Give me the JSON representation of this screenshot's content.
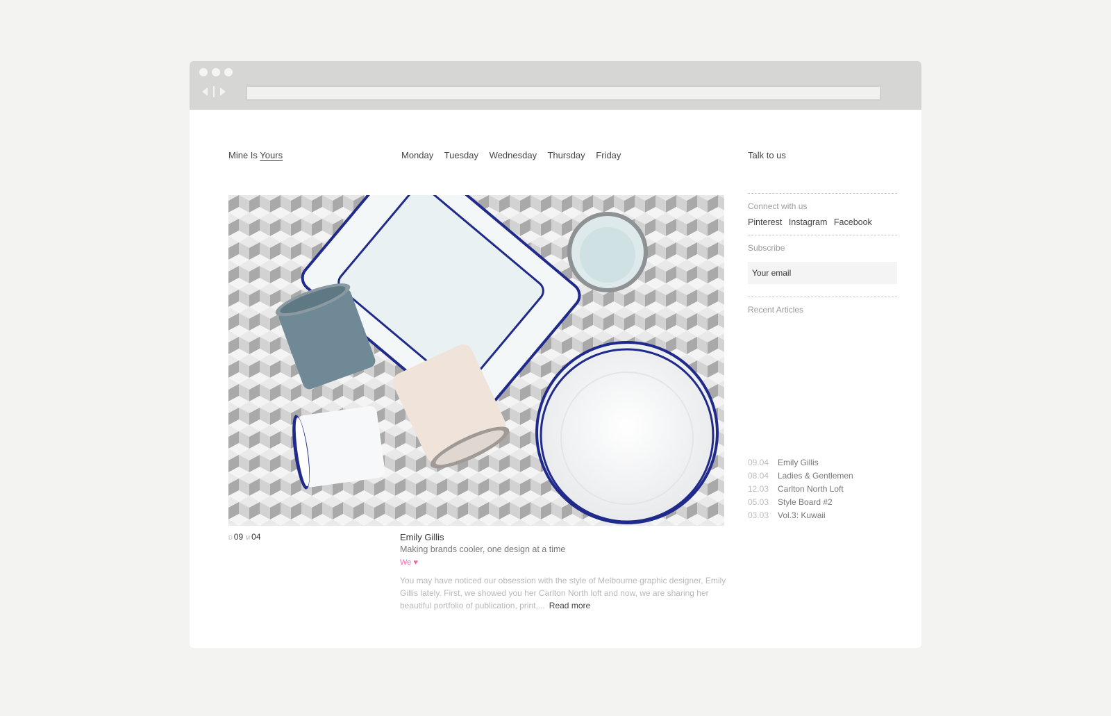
{
  "header": {
    "logo_prefix": "Mine Is",
    "logo_link": "Yours",
    "days": [
      "Monday",
      "Tuesday",
      "Wednesday",
      "Thursday",
      "Friday"
    ],
    "contact": "Talk to us"
  },
  "post": {
    "date_d_label": "D",
    "day": "09",
    "date_m_label": "M",
    "month": "04",
    "author": "Emily Gillis",
    "subtitle": "Making brands cooler, one design at a time",
    "we_label": "We",
    "excerpt": "You may have noticed our obsession with the style of Melbourne graphic designer, Emily Gillis lately. First, we showed you her Carlton North loft and now, we are sharing her beautiful portfolio of publication, print,...",
    "read_more": "Read more"
  },
  "sidebar": {
    "connect_label": "Connect with us",
    "social": [
      "Pinterest",
      "Instagram",
      "Facebook"
    ],
    "subscribe_label": "Subscribe",
    "email_placeholder": "Your email",
    "recent_label": "Recent Articles",
    "recent": [
      {
        "date": "09.04",
        "title": "Emily Gillis"
      },
      {
        "date": "08.04",
        "title": "Ladies & Gentlemen"
      },
      {
        "date": "12.03",
        "title": "Carlton North Loft"
      },
      {
        "date": "05.03",
        "title": "Style Board #2"
      },
      {
        "date": "03.03",
        "title": "Vol.3: Kuwaii"
      }
    ]
  },
  "colors": {
    "accent_pink": "#f36aa6",
    "enamel_blue": "#1f2a8a",
    "cup_grey_blue": "#6f8a96",
    "cup_cream": "#efe3da"
  }
}
